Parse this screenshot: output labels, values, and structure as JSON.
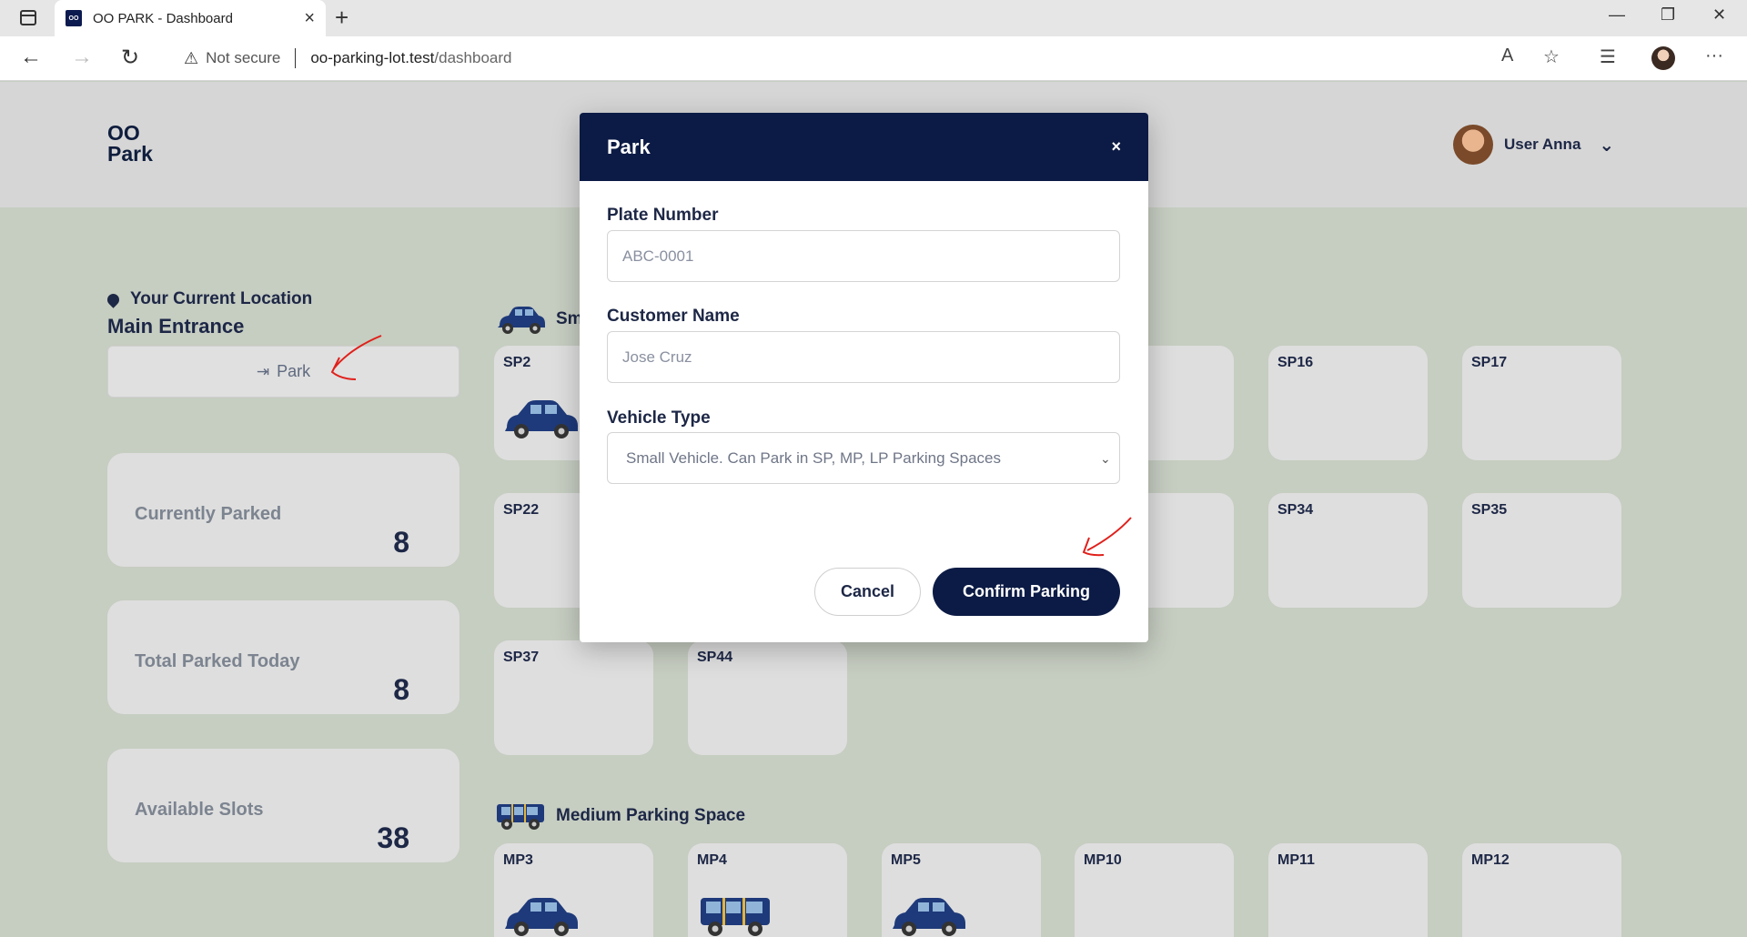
{
  "browser": {
    "tab_title": "OO PARK - Dashboard",
    "tab_favicon_text": "OO",
    "security_label": "Not secure",
    "url_host": "oo-parking-lot.test",
    "url_path": "/dashboard"
  },
  "app": {
    "logo_line1": "OO",
    "logo_line2": "Park",
    "user_name": "User Anna"
  },
  "location": {
    "title": "Your Current Location",
    "name": "Main Entrance",
    "park_button": "Park"
  },
  "stats": [
    {
      "label": "Currently Parked",
      "value": "8"
    },
    {
      "label": "Total Parked Today",
      "value": "8"
    },
    {
      "label": "Available Slots",
      "value": "38"
    }
  ],
  "sections": {
    "small_partial": "Sm",
    "medium": "Medium Parking Space"
  },
  "slots": {
    "small_row1": [
      "SP2",
      "SP16",
      "SP17"
    ],
    "small_row2": [
      "SP22",
      "SP34",
      "SP35"
    ],
    "small_row3": [
      "SP37",
      "SP44"
    ],
    "medium_row1": [
      "MP3",
      "MP4",
      "MP5",
      "MP10",
      "MP11",
      "MP12"
    ]
  },
  "modal": {
    "title": "Park",
    "close": "×",
    "plate_label": "Plate Number",
    "plate_placeholder": "ABC-0001",
    "customer_label": "Customer Name",
    "customer_placeholder": "Jose Cruz",
    "vehicle_label": "Vehicle Type",
    "vehicle_selected": "Small Vehicle. Can Park in SP, MP, LP Parking Spaces",
    "cancel": "Cancel",
    "confirm": "Confirm Parking"
  },
  "colors": {
    "navy": "#0c1b45",
    "page_bg": "#c6cdc1",
    "card_bg": "#dedede",
    "annotation": "#e0201b"
  }
}
